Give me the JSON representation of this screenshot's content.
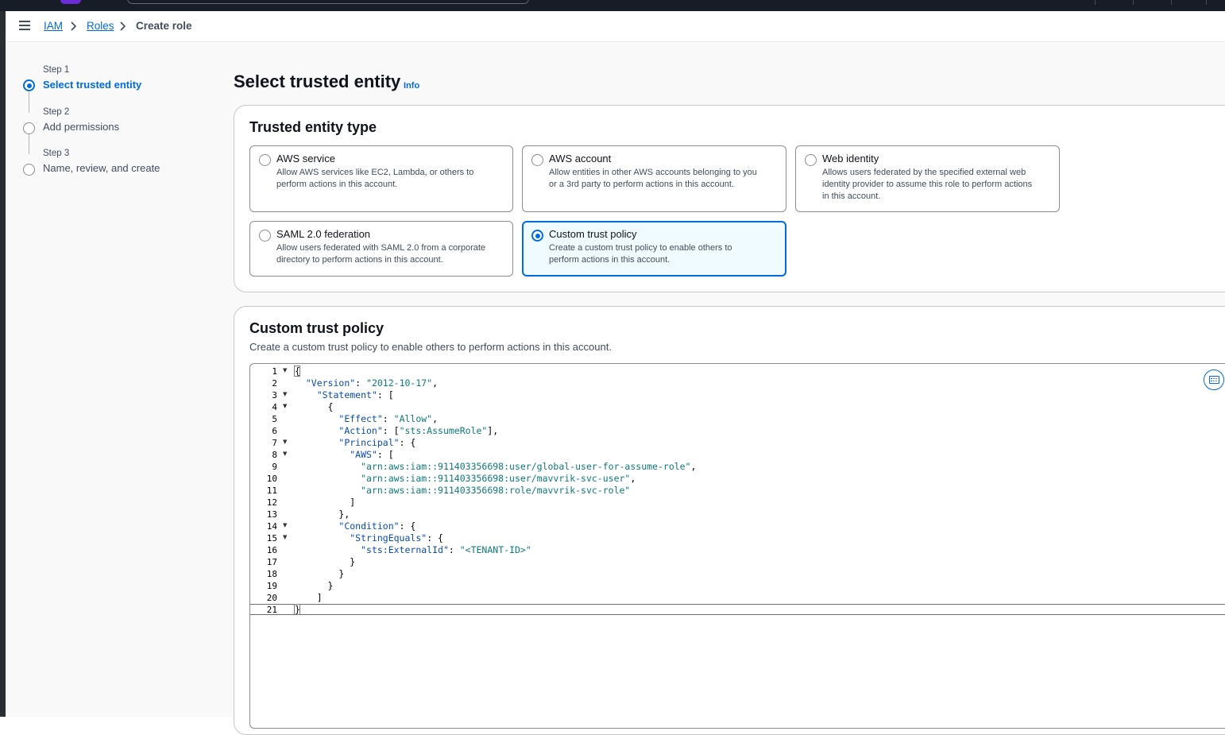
{
  "breadcrumb": {
    "items": [
      "IAM",
      "Roles"
    ],
    "current": "Create role"
  },
  "wizard": {
    "steps": [
      {
        "num": "Step 1",
        "label": "Select trusted entity"
      },
      {
        "num": "Step 2",
        "label": "Add permissions"
      },
      {
        "num": "Step 3",
        "label": "Name, review, and create"
      }
    ],
    "active_step": 1
  },
  "page": {
    "title": "Select trusted entity",
    "info": "Info"
  },
  "trusted_entity": {
    "title": "Trusted entity type",
    "options": [
      {
        "title": "AWS service",
        "desc1": "Allow AWS services like EC2, Lambda, or others to",
        "desc2": "perform actions in this account.",
        "desc3": ""
      },
      {
        "title": "AWS account",
        "desc1": "Allow entities in other AWS accounts belonging to you",
        "desc2": "or a 3rd party to perform actions in this account.",
        "desc3": ""
      },
      {
        "title": "Web identity",
        "desc1": "Allows users federated by the specified external web",
        "desc2": "identity provider to assume this role to perform actions",
        "desc3": "in this account."
      },
      {
        "title": "SAML 2.0 federation",
        "desc1": "Allow users federated with SAML 2.0 from a corporate",
        "desc2": "directory to perform actions in this account.",
        "desc3": ""
      },
      {
        "title": "Custom trust policy",
        "desc1": "Create a custom trust policy to enable others to",
        "desc2": "perform actions in this account.",
        "desc3": ""
      }
    ],
    "selected": "Custom trust policy"
  },
  "custom_policy": {
    "title": "Custom trust policy",
    "description": "Create a custom trust policy to enable others to perform actions in this account.",
    "line_numbers": [
      "1",
      "2",
      "3",
      "4",
      "5",
      "6",
      "7",
      "8",
      "9",
      "10",
      "11",
      "12",
      "13",
      "14",
      "15",
      "16",
      "17",
      "18",
      "19",
      "20",
      "21"
    ],
    "code": {
      "l1": "{",
      "l2k": "\"Version\"",
      "l2s": "\"2012-10-17\"",
      "l3k": "\"Statement\"",
      "l4": "{",
      "l5k": "\"Effect\"",
      "l5s": "\"Allow\"",
      "l6k": "\"Action\"",
      "l6s": "\"sts:AssumeRole\"",
      "l7k": "\"Principal\"",
      "l8k": "\"AWS\"",
      "l9s": "\"arn:aws:iam::911403356698:user/global-user-for-assume-role\"",
      "l10s": "\"arn:aws:iam::911403356698:user/mavvrik-svc-user\"",
      "l11s": "\"arn:aws:iam::911403356698:role/mavvrik-svc-role\"",
      "l14k": "\"Condition\"",
      "l15k": "\"StringEquals\"",
      "l16k": "\"sts:ExternalId\"",
      "l16s": "\"<TENANT-ID>\"",
      "l21": "}"
    }
  },
  "icons": {
    "menu": "hamburger-menu-icon",
    "chevron": "chevron-right-icon",
    "keyboard": "keyboard-icon",
    "fold": "fold-triangle-icon"
  },
  "colors": {
    "accent": "#006ce0",
    "topbar": "#161d26",
    "selected_tile_bg": "#f0fbff"
  }
}
